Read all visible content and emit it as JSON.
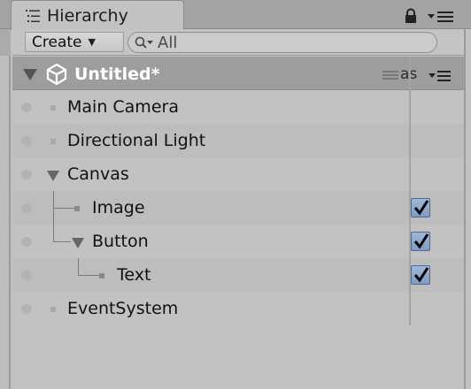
{
  "panel": {
    "tab_title": "Hierarchy",
    "tab_icon": "hierarchy-list-icon",
    "lock_icon": "padlock-icon",
    "menu_icon": "panel-menu-icon"
  },
  "toolbar": {
    "create_label": "Create",
    "search_placeholder": "All",
    "search_value": ""
  },
  "scene": {
    "title": "Untitled*",
    "column_label": "as",
    "icon": "unity-logo-icon"
  },
  "items": [
    {
      "label": "Main Camera",
      "depth": 0,
      "has_children": false,
      "checked": null
    },
    {
      "label": "Directional Light",
      "depth": 0,
      "has_children": false,
      "checked": null
    },
    {
      "label": "Canvas",
      "depth": 0,
      "has_children": true,
      "expanded": true,
      "checked": null
    },
    {
      "label": "Image",
      "depth": 1,
      "has_children": false,
      "checked": true
    },
    {
      "label": "Button",
      "depth": 1,
      "has_children": true,
      "expanded": true,
      "checked": true
    },
    {
      "label": "Text",
      "depth": 2,
      "has_children": false,
      "checked": true
    },
    {
      "label": "EventSystem",
      "depth": 0,
      "has_children": false,
      "checked": null
    }
  ],
  "colors": {
    "background": "#c2c2c2",
    "scene_header": "#9d9d9d",
    "checkbox": "#8aa6cc"
  }
}
